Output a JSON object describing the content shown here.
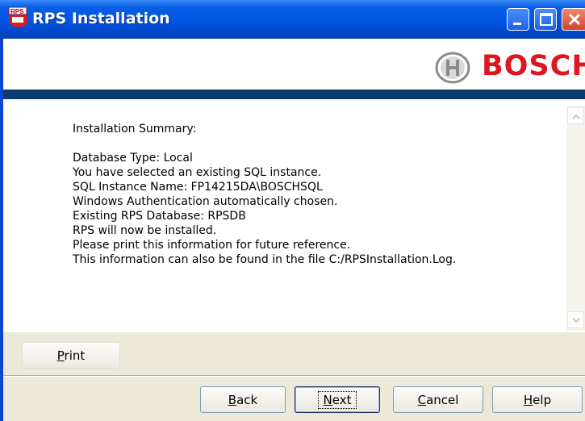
{
  "window": {
    "title": "RPS Installation",
    "icon": "rps-app-icon"
  },
  "header": {
    "brand": "BOSCH",
    "logo": "bosch-armature-logo"
  },
  "summary": {
    "heading": "Installation Summary:",
    "lines": [
      "Database Type: Local",
      "You have selected an existing SQL instance.",
      "SQL Instance Name: FP14215DA\\BOSCHSQL",
      "Windows Authentication automatically chosen.",
      "Existing RPS Database: RPSDB",
      "RPS will now be installed.",
      "Please print this information for future reference.",
      "This information can also be found in the file C:/RPSInstallation.Log."
    ]
  },
  "buttons": {
    "print": {
      "label": "Print",
      "mnemonic": "P",
      "rest": "rint"
    },
    "back": {
      "label": "Back",
      "mnemonic": "B",
      "rest": "ack"
    },
    "next": {
      "label": "Next",
      "mnemonic": "N",
      "rest": "ext"
    },
    "cancel": {
      "label": "Cancel",
      "mnemonic": "C",
      "rest": "ancel"
    },
    "help": {
      "label": "Help",
      "mnemonic": "H",
      "rest": "elp"
    }
  },
  "colors": {
    "accent": "#0054e3",
    "brand": "#e0161f",
    "band": "#0c3b6e"
  }
}
